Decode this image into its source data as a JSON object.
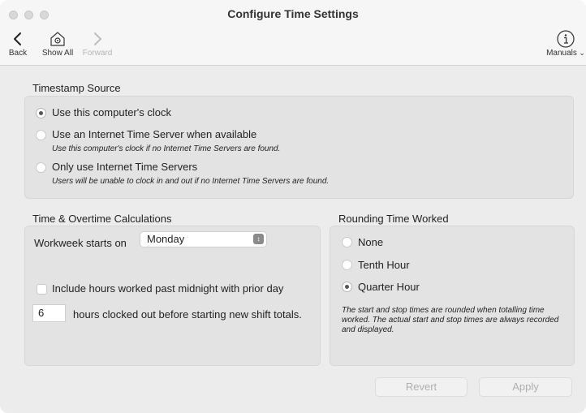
{
  "window": {
    "title": "Configure Time Settings"
  },
  "toolbar": {
    "back_label": "Back",
    "show_all_label": "Show All",
    "forward_label": "Forward",
    "manuals_label": "Manuals"
  },
  "timestamp": {
    "section_label": "Timestamp Source",
    "options": [
      {
        "label": "Use this computer's clock",
        "note": "",
        "selected": true
      },
      {
        "label": "Use an Internet Time Server when available",
        "note": "Use this computer's clock if no Internet Time Servers are found.",
        "selected": false
      },
      {
        "label": "Only use Internet Time Servers",
        "note": "Users will be unable to clock in and out if no Internet Time Servers are found.",
        "selected": false
      }
    ]
  },
  "overtime": {
    "section_label": "Time & Overtime Calculations",
    "workweek_label": "Workweek starts on",
    "workweek_value": "Monday",
    "midnight_label": "Include hours worked past midnight with prior day",
    "midnight_checked": false,
    "hours_value": "6",
    "hours_label": "hours clocked out before starting new shift totals."
  },
  "rounding": {
    "section_label": "Rounding Time Worked",
    "options": [
      {
        "label": "None",
        "selected": false
      },
      {
        "label": "Tenth Hour",
        "selected": false
      },
      {
        "label": "Quarter Hour",
        "selected": true
      }
    ],
    "note": "The start and stop times are rounded when totalling time worked. The actual start and stop times are always recorded and displayed."
  },
  "buttons": {
    "revert_label": "Revert",
    "apply_label": "Apply"
  }
}
